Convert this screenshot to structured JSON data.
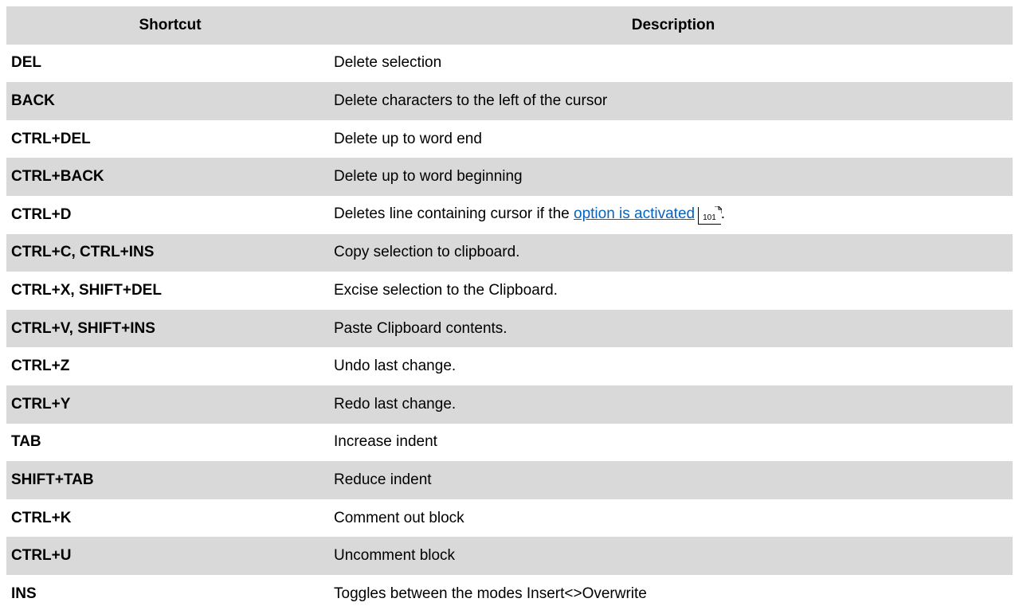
{
  "header": {
    "shortcut": "Shortcut",
    "description": "Description"
  },
  "rows": [
    {
      "shortcut": "DEL",
      "description": "Delete selection"
    },
    {
      "shortcut": "BACK",
      "description": "Delete characters to the left of the cursor"
    },
    {
      "shortcut": "CTRL+DEL",
      "description": "Delete up to word end"
    },
    {
      "shortcut": "CTRL+BACK",
      "description": "Delete up to word beginning"
    },
    {
      "shortcut": "CTRL+D",
      "description_prefix": "Deletes line containing cursor if the ",
      "link_text": "option is activated",
      "page_ref": "101",
      "description_suffix": "."
    },
    {
      "shortcut": "CTRL+C, CTRL+INS",
      "description": "Copy selection to clipboard."
    },
    {
      "shortcut": "CTRL+X, SHIFT+DEL",
      "description": "Excise selection to the Clipboard."
    },
    {
      "shortcut": "CTRL+V, SHIFT+INS",
      "description": "Paste Clipboard contents."
    },
    {
      "shortcut": "CTRL+Z",
      "description": "Undo last change."
    },
    {
      "shortcut": "CTRL+Y",
      "description": "Redo last change."
    },
    {
      "shortcut": "TAB",
      "description": "Increase indent"
    },
    {
      "shortcut": "SHIFT+TAB",
      "description": "Reduce indent"
    },
    {
      "shortcut": "CTRL+K",
      "description": "Comment out block"
    },
    {
      "shortcut": "CTRL+U",
      "description": "Uncomment block"
    },
    {
      "shortcut": "INS",
      "description": "Toggles between the modes Insert<>Overwrite"
    }
  ],
  "colors": {
    "header_bg": "#d9d9d9",
    "row_shade": "#d9d9d9",
    "link": "#0563c1"
  }
}
